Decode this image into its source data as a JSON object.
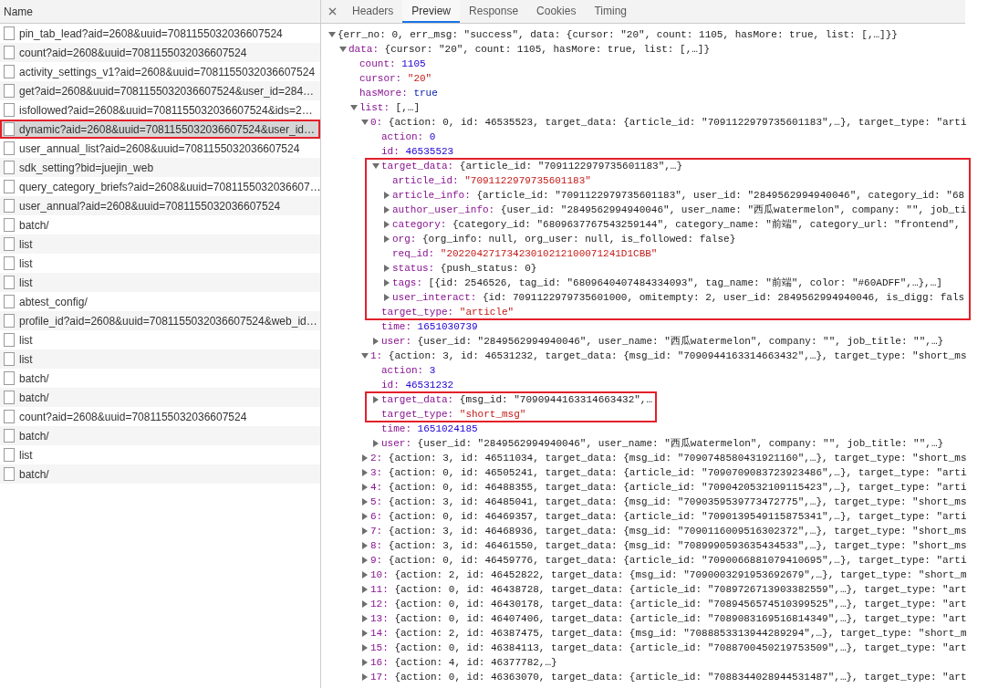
{
  "requests": {
    "header": "Name",
    "items": [
      {
        "name": "pin_tab_lead?aid=2608&uuid=7081155032036607524",
        "selected": false,
        "highlighted": false
      },
      {
        "name": "count?aid=2608&uuid=7081155032036607524",
        "selected": false,
        "highlighted": false
      },
      {
        "name": "activity_settings_v1?aid=2608&uuid=7081155032036607524",
        "selected": false,
        "highlighted": false
      },
      {
        "name": "get?aid=2608&uuid=7081155032036607524&user_id=284…",
        "selected": false,
        "highlighted": false
      },
      {
        "name": "isfollowed?aid=2608&uuid=7081155032036607524&ids=2…",
        "selected": false,
        "highlighted": false
      },
      {
        "name": "dynamic?aid=2608&uuid=7081155032036607524&user_id…",
        "selected": true,
        "highlighted": true
      },
      {
        "name": "user_annual_list?aid=2608&uuid=7081155032036607524",
        "selected": false,
        "highlighted": false
      },
      {
        "name": "sdk_setting?bid=juejin_web",
        "selected": false,
        "highlighted": false
      },
      {
        "name": "query_category_briefs?aid=2608&uuid=7081155032036607…",
        "selected": false,
        "highlighted": false
      },
      {
        "name": "user_annual?aid=2608&uuid=7081155032036607524",
        "selected": false,
        "highlighted": false
      },
      {
        "name": "batch/",
        "selected": false,
        "highlighted": false
      },
      {
        "name": "list",
        "selected": false,
        "highlighted": false
      },
      {
        "name": "list",
        "selected": false,
        "highlighted": false
      },
      {
        "name": "list",
        "selected": false,
        "highlighted": false
      },
      {
        "name": "abtest_config/",
        "selected": false,
        "highlighted": false
      },
      {
        "name": "profile_id?aid=2608&uuid=7081155032036607524&web_id…",
        "selected": false,
        "highlighted": false
      },
      {
        "name": "list",
        "selected": false,
        "highlighted": false
      },
      {
        "name": "list",
        "selected": false,
        "highlighted": false
      },
      {
        "name": "batch/",
        "selected": false,
        "highlighted": false
      },
      {
        "name": "batch/",
        "selected": false,
        "highlighted": false
      },
      {
        "name": "count?aid=2608&uuid=7081155032036607524",
        "selected": false,
        "highlighted": false
      },
      {
        "name": "batch/",
        "selected": false,
        "highlighted": false
      },
      {
        "name": "list",
        "selected": false,
        "highlighted": false
      },
      {
        "name": "batch/",
        "selected": false,
        "highlighted": false
      }
    ]
  },
  "detail": {
    "tabs": [
      {
        "label": "Headers",
        "selected": false
      },
      {
        "label": "Preview",
        "selected": true
      },
      {
        "label": "Response",
        "selected": false
      },
      {
        "label": "Cookies",
        "selected": false
      },
      {
        "label": "Timing",
        "selected": false
      }
    ],
    "tree": {
      "kind": "object",
      "value": "{err_no: 0, err_msg: \"success\", data: {cursor: \"20\", count: 1105, hasMore: true, list: [,…]}}",
      "expanded": true,
      "children": [
        {
          "key": "data:",
          "kind": "object",
          "value": "{cursor: \"20\", count: 1105, hasMore: true, list: [,…]}",
          "expanded": true,
          "children": [
            {
              "key": "count:",
              "kind": "number",
              "value": "1105"
            },
            {
              "key": "cursor:",
              "kind": "string",
              "value": "\"20\""
            },
            {
              "key": "hasMore:",
              "kind": "boolean",
              "value": "true"
            },
            {
              "key": "list:",
              "kind": "object",
              "value": "[,…]",
              "expanded": true,
              "children": [
                {
                  "key": "0:",
                  "kind": "object",
                  "value": "{action: 0, id: 46535523, target_data: {article_id: \"7091122979735601183\",…}, target_type: \"arti",
                  "expanded": true,
                  "children": [
                    {
                      "key": "action:",
                      "kind": "number",
                      "value": "0",
                      "highlighted": false
                    },
                    {
                      "key": "id:",
                      "kind": "number",
                      "value": "46535523",
                      "highlighted": false
                    },
                    {
                      "key": "target_data:",
                      "kind": "object",
                      "value": "{article_id: \"7091122979735601183\",…}",
                      "expanded": true,
                      "highlighted": true,
                      "children": [
                        {
                          "key": "article_id:",
                          "kind": "string",
                          "value": "\"7091122979735601183\""
                        },
                        {
                          "key": "article_info:",
                          "kind": "object",
                          "value": "{article_id: \"7091122979735601183\", user_id: \"2849562994940046\", category_id: \"68",
                          "expanded": false
                        },
                        {
                          "key": "author_user_info:",
                          "kind": "object",
                          "value": "{user_id: \"2849562994940046\", user_name: \"西瓜watermelon\", company: \"\", job_ti",
                          "expanded": false
                        },
                        {
                          "key": "category:",
                          "kind": "object",
                          "value": "{category_id: \"6809637767543259144\", category_name: \"前端\", category_url: \"frontend\",",
                          "expanded": false
                        },
                        {
                          "key": "org:",
                          "kind": "object",
                          "value": "{org_info: null, org_user: null, is_followed: false}",
                          "expanded": false
                        },
                        {
                          "key": "req_id:",
                          "kind": "string",
                          "value": "\"20220427173423010212100071241D1CBB\""
                        },
                        {
                          "key": "status:",
                          "kind": "object",
                          "value": "{push_status: 0}",
                          "expanded": false
                        },
                        {
                          "key": "tags:",
                          "kind": "object",
                          "value": "[{id: 2546526, tag_id: \"6809640407484334093\", tag_name: \"前端\", color: \"#60ADFF\",…},…]",
                          "expanded": false
                        },
                        {
                          "key": "user_interact:",
                          "kind": "object",
                          "value": "{id: 7091122979735601000, omitempty: 2, user_id: 2849562994940046, is_digg: fals",
                          "expanded": false
                        }
                      ]
                    },
                    {
                      "key": "target_type:",
                      "kind": "string",
                      "value": "\"article\"",
                      "highlighted": true
                    },
                    {
                      "key": "time:",
                      "kind": "number",
                      "value": "1651030739",
                      "highlighted": false
                    },
                    {
                      "key": "user:",
                      "kind": "object",
                      "value": "{user_id: \"2849562994940046\", user_name: \"西瓜watermelon\", company: \"\", job_title: \"\",…}",
                      "expanded": false,
                      "highlighted": false
                    }
                  ]
                },
                {
                  "key": "1:",
                  "kind": "object",
                  "value": "{action: 3, id: 46531232, target_data: {msg_id: \"7090944163314663432\",…}, target_type: \"short_ms",
                  "expanded": true,
                  "children": [
                    {
                      "key": "action:",
                      "kind": "number",
                      "value": "3",
                      "highlighted": false
                    },
                    {
                      "key": "id:",
                      "kind": "number",
                      "value": "46531232",
                      "highlighted": false
                    },
                    {
                      "key": "target_data:",
                      "kind": "object",
                      "value": "{msg_id: \"7090944163314663432\",…",
                      "expanded": false,
                      "highlighted": true
                    },
                    {
                      "key": "target_type:",
                      "kind": "string",
                      "value": "\"short_msg\"",
                      "highlighted": true
                    },
                    {
                      "key": "time:",
                      "kind": "number",
                      "value": "1651024185",
                      "highlighted": false
                    },
                    {
                      "key": "user:",
                      "kind": "object",
                      "value": "{user_id: \"2849562994940046\", user_name: \"西瓜watermelon\", company: \"\", job_title: \"\",…}",
                      "expanded": false,
                      "highlighted": false
                    }
                  ]
                },
                {
                  "key": "2:",
                  "kind": "object",
                  "value": "{action: 3, id: 46511034, target_data: {msg_id: \"7090748580431921160\",…}, target_type: \"short_ms",
                  "expanded": false
                },
                {
                  "key": "3:",
                  "kind": "object",
                  "value": "{action: 0, id: 46505241, target_data: {article_id: \"7090709083723923486\",…}, target_type: \"arti",
                  "expanded": false
                },
                {
                  "key": "4:",
                  "kind": "object",
                  "value": "{action: 0, id: 46488355, target_data: {article_id: \"7090420532109115423\",…}, target_type: \"arti",
                  "expanded": false
                },
                {
                  "key": "5:",
                  "kind": "object",
                  "value": "{action: 3, id: 46485041, target_data: {msg_id: \"7090359539773472775\",…}, target_type: \"short_ms",
                  "expanded": false
                },
                {
                  "key": "6:",
                  "kind": "object",
                  "value": "{action: 0, id: 46469357, target_data: {article_id: \"7090139549115875341\",…}, target_type: \"arti",
                  "expanded": false
                },
                {
                  "key": "7:",
                  "kind": "object",
                  "value": "{action: 3, id: 46468936, target_data: {msg_id: \"7090116009516302372\",…}, target_type: \"short_ms",
                  "expanded": false
                },
                {
                  "key": "8:",
                  "kind": "object",
                  "value": "{action: 3, id: 46461550, target_data: {msg_id: \"7089990593635434533\",…}, target_type: \"short_ms",
                  "expanded": false
                },
                {
                  "key": "9:",
                  "kind": "object",
                  "value": "{action: 0, id: 46459776, target_data: {article_id: \"7090066881079410695\",…}, target_type: \"arti",
                  "expanded": false
                },
                {
                  "key": "10:",
                  "kind": "object",
                  "value": "{action: 2, id: 46452822, target_data: {msg_id: \"7090003291953692679\",…}, target_type: \"short_m",
                  "expanded": false
                },
                {
                  "key": "11:",
                  "kind": "object",
                  "value": "{action: 0, id: 46438728, target_data: {article_id: \"7089726713903382559\",…}, target_type: \"art",
                  "expanded": false
                },
                {
                  "key": "12:",
                  "kind": "object",
                  "value": "{action: 0, id: 46430178, target_data: {article_id: \"7089456574510399525\",…}, target_type: \"art",
                  "expanded": false
                },
                {
                  "key": "13:",
                  "kind": "object",
                  "value": "{action: 0, id: 46407406, target_data: {article_id: \"7089083169516814349\",…}, target_type: \"art",
                  "expanded": false
                },
                {
                  "key": "14:",
                  "kind": "object",
                  "value": "{action: 2, id: 46387475, target_data: {msg_id: \"7088853313944289294\",…}, target_type: \"short_m",
                  "expanded": false
                },
                {
                  "key": "15:",
                  "kind": "object",
                  "value": "{action: 0, id: 46384113, target_data: {article_id: \"7088700450219753509\",…}, target_type: \"art",
                  "expanded": false
                },
                {
                  "key": "16:",
                  "kind": "object",
                  "value": "{action: 4, id: 46377782,…}",
                  "expanded": false
                },
                {
                  "key": "17:",
                  "kind": "object",
                  "value": "{action: 0, id: 46363070, target_data: {article_id: \"7088344028944531487\",…}, target_type: \"art",
                  "expanded": false
                }
              ]
            }
          ]
        }
      ]
    }
  }
}
